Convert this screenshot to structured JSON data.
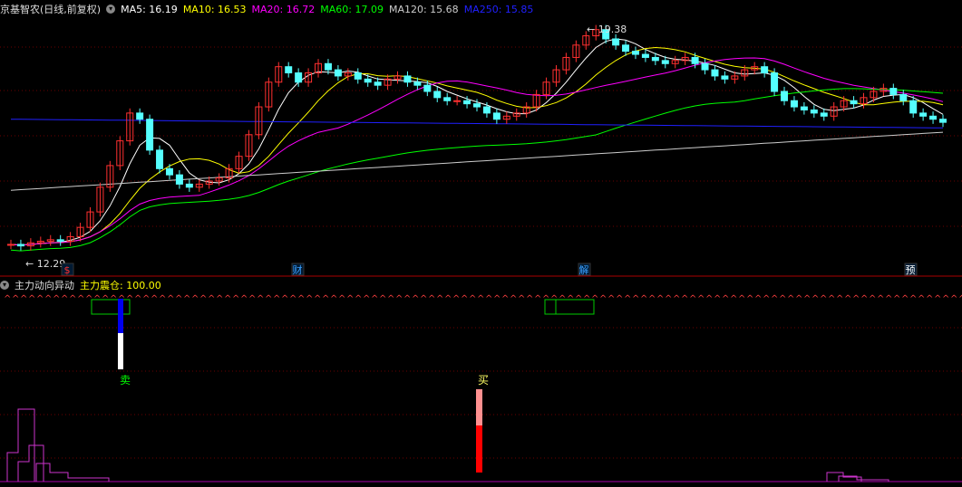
{
  "price_panel": {
    "stock_name": "京基智农(日线,前复权)",
    "ma_labels": [
      {
        "text": "MA5: 16.19",
        "color": "#ffffff"
      },
      {
        "text": "MA10: 16.53",
        "color": "#ffff00"
      },
      {
        "text": "MA20: 16.72",
        "color": "#ff00ff"
      },
      {
        "text": "MA60: 17.09",
        "color": "#00ff00"
      },
      {
        "text": "MA120: 15.68",
        "color": "#cccccc"
      },
      {
        "text": "MA250: 15.85",
        "color": "#2020ff"
      }
    ],
    "high_label": "19.38",
    "low_label": "12.29",
    "event_markers": [
      {
        "text": "$",
        "color": "#ff3030"
      },
      {
        "text": "财",
        "color": "#3aa0ff"
      },
      {
        "text": "解",
        "color": "#3aa0ff"
      },
      {
        "text": "预",
        "color": "#ffffff"
      }
    ]
  },
  "indicator_panel": {
    "title": "主力动向异动",
    "value_label": "主力震仓: 100.00",
    "sell_label": "卖",
    "buy_label": "买"
  },
  "colors": {
    "up_candle": "#ff3030",
    "down_candle": "#55ffff",
    "ma5": "#ffffff",
    "ma10": "#ffff00",
    "ma20": "#ff00ff",
    "ma60": "#00ff00",
    "ma120": "#cccccc",
    "ma250": "#2020ff",
    "grid": "#6a0000"
  },
  "chart_data": {
    "type": "candlestick",
    "price_range": [
      12.29,
      19.38
    ]
  }
}
